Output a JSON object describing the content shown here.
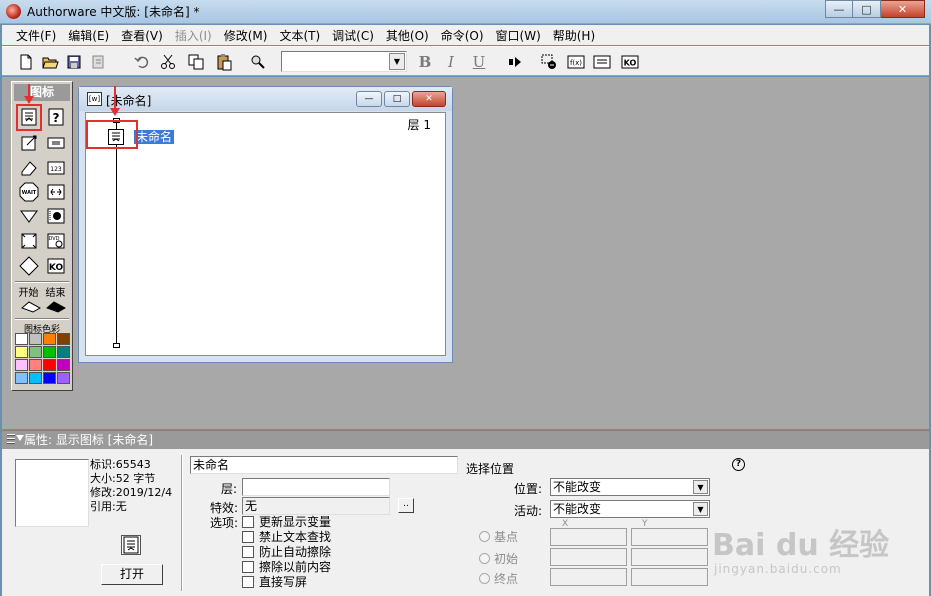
{
  "window": {
    "title": "Authorware 中文版: [未命名] *"
  },
  "menu": [
    "文件(F)",
    "编辑(E)",
    "查看(V)",
    "插入(I)",
    "修改(M)",
    "文本(T)",
    "调试(C)",
    "其他(O)",
    "命令(O)",
    "窗口(W)",
    "帮助(H)"
  ],
  "menu_disabled": [
    "插入(I)"
  ],
  "toolbar": {
    "bold": "B",
    "italic": "I",
    "underline": "U",
    "font_value": ""
  },
  "palette": {
    "title": "图标",
    "start_label": "开始",
    "end_label": "结束",
    "color_label": "图标色彩",
    "swatches": [
      "#ffffff",
      "#c0c0c0",
      "#ff8000",
      "#804000",
      "#ffff80",
      "#80c080",
      "#00c000",
      "#008080",
      "#ffc0ff",
      "#ff8080",
      "#ff0000",
      "#c000c0",
      "#80c0ff",
      "#00c0ff",
      "#0000ff",
      "#a060ff"
    ]
  },
  "flow_window": {
    "title": "[未命名]",
    "layer": "层 1",
    "icon_label": "未命名"
  },
  "properties": {
    "title": "属性: 显示图标 [未命名]",
    "id_line": "标识:65543",
    "size_line": "大小:52 字节",
    "modified_line": "修改:2019/12/4",
    "ref_line": "引用:无",
    "open_button": "打开",
    "name_value": "未命名",
    "layer_label": "层:",
    "layer_value": "",
    "effect_label": "特效:",
    "effect_value": "无",
    "options_label": "选项:",
    "options": [
      "更新显示变量",
      "禁止文本查找",
      "防止自动擦除",
      "擦除以前内容",
      "直接写屏"
    ],
    "choose_position": "选择位置",
    "position_label": "位置:",
    "position_value": "不能改变",
    "activity_label": "活动:",
    "activity_value": "不能改变",
    "radio_base": "基点",
    "radio_initial": "初始",
    "radio_end": "终点",
    "x_header": "X",
    "y_header": "Y",
    "help": "?"
  },
  "watermark": {
    "main": "Bai du 经验",
    "sub": "jingyan.baidu.com"
  }
}
